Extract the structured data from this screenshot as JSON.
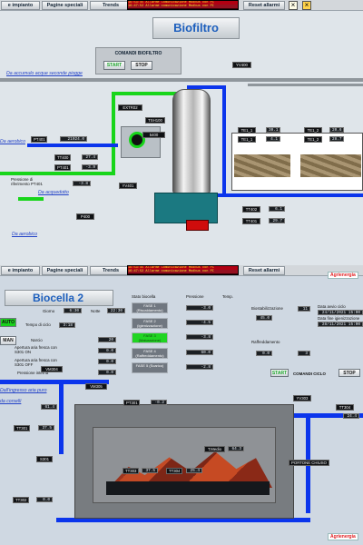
{
  "top": {
    "nav": [
      "e impianto",
      "Pagine speciali",
      "Trends",
      "Reset allarmi"
    ],
    "alarms": [
      "16:53:45 Allarme Comunicazione Modbus con PC",
      "16:47:52 Allarme comunicazione Modbus con PI"
    ],
    "title": "Biofiltro",
    "command_panel": {
      "title": "COMANDI BIOFILTRO",
      "start": "START",
      "stop": "STOP"
    },
    "links": [
      "Da accumulo acque seconde piogge",
      "Da aerobico",
      "Da acquedotto",
      "Da aerobico"
    ],
    "tags": [
      "YV400",
      "EXTR02",
      "TSH100",
      "5400",
      "YV401",
      "P400",
      "PT401",
      "TT400",
      "PT401",
      "TT401",
      "PT402",
      "TT402",
      "TT401",
      "TE1_1",
      "TE1_2",
      "TE1_1",
      "TE1_2"
    ],
    "values": [
      "21024.0",
      "27.4",
      "-3.9",
      "43.0",
      "-3.8",
      "30.1",
      "20.6",
      "6.1",
      "29.7",
      "4.1",
      "28.7"
    ],
    "pressure_label": "Pressione di riferimento PT401",
    "units": [
      "%",
      "mbar",
      "°C",
      "mbar"
    ]
  },
  "bottom": {
    "nav": [
      "e impianto",
      "Pagine speciali",
      "Trends",
      "Reset allarmi"
    ],
    "alarms": [
      "16:53:45 Allarme Comunicazione Modbus con PC",
      "16:47:52 Allarme comunicazione Modbus con PI"
    ],
    "title": "Biocella 2",
    "left_labels": [
      "Giorno",
      "Notte",
      "Tempo di ciclo",
      "Narcio",
      "Apertura aria fresca con S301 ON",
      "Apertura aria fresca con S301 OFF",
      "Pressione interna"
    ],
    "left_values": [
      "6:30",
      "22:30",
      "3:18",
      "20",
      "0.0",
      "0.0",
      "0.0",
      "0.0",
      "0.0"
    ],
    "auto": "AUTO",
    "manual": "MAN",
    "table_headers": [
      "Stato biocella",
      "Pressione",
      "Temp."
    ],
    "phases": [
      {
        "label": "FASE 1 (Riscaldamento)",
        "pressure": "-3.0",
        "temp": "",
        "active": false
      },
      {
        "label": "FASE 2 (Igienizzazione)",
        "pressure": "-4.5",
        "temp": "",
        "active": false
      },
      {
        "label": "FASE 3 (Maturazione)",
        "pressure": "-3.8",
        "temp": "",
        "active": true
      },
      {
        "label": "FASE 4 (Raffreddamento)",
        "pressure": "60.0",
        "temp": "",
        "active": false
      },
      {
        "label": "FASE 5 (Scarico)",
        "pressure": "-2.8",
        "temp": "",
        "active": false
      }
    ],
    "right_panel": {
      "labels": [
        "Biostabilizzazione",
        "Raffreddamento",
        "Data avvio ciclo",
        "Data fine igienizzazione",
        "Data fine stabilizzazione",
        "Data fine ciclo stabilizzazione",
        "Data inizio fase"
      ],
      "values": [
        "11",
        "45.0",
        "3",
        "0.0",
        "24/11/2021 15:00",
        "28/11/2021 15:00"
      ],
      "start": "START",
      "stop": "STOP",
      "comandi": "COMANDI CICLO"
    },
    "plant": {
      "links": [
        "Dall'ingresso aria puro",
        "da corselli"
      ],
      "tags": [
        "VM304",
        "VM305",
        "PT301",
        "TT301",
        "S301",
        "TT302",
        "TT303",
        "TT304",
        "YV303",
        "TT304",
        "PT304",
        "T.Medio",
        "PORTONE CHIUSO"
      ],
      "values": [
        "61.4",
        "37.5",
        "48.5",
        "-0.2",
        "37.5",
        "25.4",
        "42.3",
        "41.0",
        "57.4",
        "64.3",
        "24.4",
        "0.0"
      ]
    }
  },
  "colors": {
    "green": "#18d51a",
    "blue": "#0b35ec",
    "title_blue": "#1d5fbd",
    "dark_value": "#1b1f23",
    "alarm_red": "#b10012"
  }
}
